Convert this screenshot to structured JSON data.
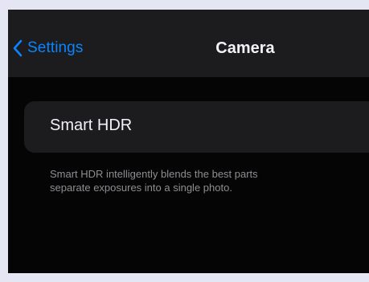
{
  "navbar": {
    "back_label": "Settings",
    "back_icon": "chevron-left-icon",
    "title": "Camera"
  },
  "settings_group": {
    "row_label": "Smart HDR"
  },
  "footer": {
    "line1": "Smart HDR intelligently blends the best parts",
    "line2": "separate exposures into a single photo."
  },
  "colors": {
    "accent": "#0a84ff",
    "background": "#050505",
    "cell": "#1c1c1e",
    "primary_text": "#f2f2f7",
    "secondary_text": "#8e8e93",
    "page_margin": "#e4e7f3"
  }
}
